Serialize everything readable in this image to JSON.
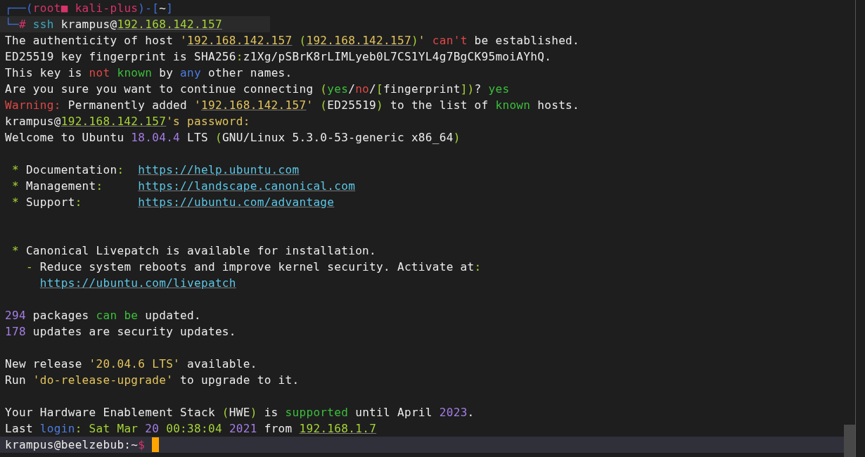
{
  "terminal": {
    "lines": [
      {
        "kind": "text",
        "highlighted": false,
        "segments": [
          {
            "kind": "frame",
            "text": "┌──("
          },
          {
            "kind": "root",
            "text": "root■ kali-plus"
          },
          {
            "kind": "frame",
            "text": ")-["
          },
          {
            "kind": "plain",
            "text": "~"
          },
          {
            "kind": "frame",
            "text": "]"
          }
        ]
      },
      {
        "kind": "text",
        "highlighted": true,
        "segments": [
          {
            "kind": "frame",
            "text": "└─"
          },
          {
            "kind": "root",
            "text": "#"
          },
          {
            "kind": "cmd",
            "text": " ssh"
          },
          {
            "kind": "plain",
            "text": " krampus@"
          },
          {
            "kind": "ip",
            "text": "192.168.142.157"
          }
        ]
      },
      {
        "kind": "text",
        "highlighted": false,
        "segments": [
          {
            "kind": "plain",
            "text": "The authenticity of host "
          },
          {
            "kind": "str",
            "text": "'"
          },
          {
            "kind": "strip",
            "text": "192.168.142.157"
          },
          {
            "kind": "punct",
            "text": " ("
          },
          {
            "kind": "strip",
            "text": "192.168.142.157"
          },
          {
            "kind": "punct",
            "text": ")"
          },
          {
            "kind": "str",
            "text": "' "
          },
          {
            "kind": "red",
            "text": "can't"
          },
          {
            "kind": "plain",
            "text": " be established."
          }
        ]
      },
      {
        "kind": "text",
        "highlighted": false,
        "segments": [
          {
            "kind": "plain",
            "text": "ED25519 key fingerprint is SHA256"
          },
          {
            "kind": "punct",
            "text": ":"
          },
          {
            "kind": "plain",
            "text": "z1Xg/pSBrK8rLIMLyeb0L7CS1YL4g7BgCK95moiAYhQ."
          }
        ]
      },
      {
        "kind": "text",
        "highlighted": false,
        "segments": [
          {
            "kind": "plain",
            "text": "This key is "
          },
          {
            "kind": "red",
            "text": "not "
          },
          {
            "kind": "green",
            "text": "known"
          },
          {
            "kind": "plain",
            "text": " by "
          },
          {
            "kind": "blue",
            "text": "any"
          },
          {
            "kind": "plain",
            "text": " other names."
          }
        ]
      },
      {
        "kind": "text",
        "highlighted": false,
        "segments": [
          {
            "kind": "plain",
            "text": "Are you sure you want to continue connecting "
          },
          {
            "kind": "punct",
            "text": "("
          },
          {
            "kind": "green",
            "text": "yes"
          },
          {
            "kind": "plain",
            "text": "/"
          },
          {
            "kind": "red",
            "text": "no"
          },
          {
            "kind": "plain",
            "text": "/"
          },
          {
            "kind": "punct",
            "text": "["
          },
          {
            "kind": "plain",
            "text": "fingerprint"
          },
          {
            "kind": "punct",
            "text": "])"
          },
          {
            "kind": "plain",
            "text": "? "
          },
          {
            "kind": "green",
            "text": "yes"
          }
        ]
      },
      {
        "kind": "text",
        "highlighted": false,
        "segments": [
          {
            "kind": "red",
            "text": "Warning:"
          },
          {
            "kind": "plain",
            "text": " Permanently added "
          },
          {
            "kind": "str",
            "text": "'"
          },
          {
            "kind": "strip",
            "text": "192.168.142.157"
          },
          {
            "kind": "str",
            "text": "' "
          },
          {
            "kind": "punct",
            "text": "("
          },
          {
            "kind": "plain",
            "text": "ED25519"
          },
          {
            "kind": "punct",
            "text": ")"
          },
          {
            "kind": "plain",
            "text": " to the list of "
          },
          {
            "kind": "green",
            "text": "known"
          },
          {
            "kind": "plain",
            "text": " hosts."
          }
        ]
      },
      {
        "kind": "text",
        "highlighted": false,
        "segments": [
          {
            "kind": "plain",
            "text": "krampus@"
          },
          {
            "kind": "ip",
            "text": "192.168.142.157"
          },
          {
            "kind": "str",
            "text": "'s password:"
          }
        ]
      },
      {
        "kind": "text",
        "highlighted": false,
        "segments": [
          {
            "kind": "plain",
            "text": "Welcome to Ubuntu "
          },
          {
            "kind": "num",
            "text": "18.04.4"
          },
          {
            "kind": "plain",
            "text": " LTS "
          },
          {
            "kind": "punct",
            "text": "("
          },
          {
            "kind": "plain",
            "text": "GNU/Linux 5.3.0-53-generic x86_64"
          },
          {
            "kind": "punct",
            "text": ")"
          }
        ]
      },
      {
        "kind": "blank",
        "highlighted": false
      },
      {
        "kind": "text",
        "highlighted": false,
        "segments": [
          {
            "kind": "punct",
            "text": " *"
          },
          {
            "kind": "plain",
            "text": " Documentation"
          },
          {
            "kind": "punct",
            "text": ":  "
          },
          {
            "kind": "link",
            "text": "https://help.ubuntu.com"
          }
        ]
      },
      {
        "kind": "text",
        "highlighted": false,
        "segments": [
          {
            "kind": "punct",
            "text": " *"
          },
          {
            "kind": "plain",
            "text": " Management"
          },
          {
            "kind": "punct",
            "text": ":     "
          },
          {
            "kind": "link",
            "text": "https://landscape.canonical.com"
          }
        ]
      },
      {
        "kind": "text",
        "highlighted": false,
        "segments": [
          {
            "kind": "punct",
            "text": " *"
          },
          {
            "kind": "plain",
            "text": " Support"
          },
          {
            "kind": "punct",
            "text": ":        "
          },
          {
            "kind": "link",
            "text": "https://ubuntu.com/advantage"
          }
        ]
      },
      {
        "kind": "blank",
        "highlighted": false
      },
      {
        "kind": "blank",
        "highlighted": false
      },
      {
        "kind": "text",
        "highlighted": false,
        "segments": [
          {
            "kind": "punct",
            "text": " *"
          },
          {
            "kind": "plain",
            "text": " Canonical Livepatch is available for installation."
          }
        ]
      },
      {
        "kind": "text",
        "highlighted": false,
        "segments": [
          {
            "kind": "punct",
            "text": "   -"
          },
          {
            "kind": "plain",
            "text": " Reduce system reboots and improve kernel security. Activate at"
          },
          {
            "kind": "punct",
            "text": ":"
          }
        ]
      },
      {
        "kind": "indented",
        "highlighted": false,
        "segments": [
          {
            "kind": "link",
            "text": "https://ubuntu.com/livepatch"
          }
        ]
      },
      {
        "kind": "blank",
        "highlighted": false
      },
      {
        "kind": "text",
        "highlighted": false,
        "segments": [
          {
            "kind": "num",
            "text": "294"
          },
          {
            "kind": "plain",
            "text": " packages "
          },
          {
            "kind": "green",
            "text": "can be"
          },
          {
            "kind": "plain",
            "text": " updated."
          }
        ]
      },
      {
        "kind": "text",
        "highlighted": false,
        "segments": [
          {
            "kind": "num",
            "text": "178"
          },
          {
            "kind": "plain",
            "text": " updates are security updates."
          }
        ]
      },
      {
        "kind": "blank",
        "highlighted": false
      },
      {
        "kind": "text",
        "highlighted": false,
        "segments": [
          {
            "kind": "plain",
            "text": "New release "
          },
          {
            "kind": "str",
            "text": "'20.04.6 LTS'"
          },
          {
            "kind": "plain",
            "text": " available."
          }
        ]
      },
      {
        "kind": "text",
        "highlighted": false,
        "segments": [
          {
            "kind": "plain",
            "text": "Run "
          },
          {
            "kind": "str",
            "text": "'do-release-upgrade'"
          },
          {
            "kind": "plain",
            "text": " to upgrade to it."
          }
        ]
      },
      {
        "kind": "blank",
        "highlighted": false
      },
      {
        "kind": "text",
        "highlighted": false,
        "segments": [
          {
            "kind": "plain",
            "text": "Your Hardware Enablement Stack "
          },
          {
            "kind": "punct",
            "text": "("
          },
          {
            "kind": "plain",
            "text": "HWE"
          },
          {
            "kind": "punct",
            "text": ")"
          },
          {
            "kind": "plain",
            "text": " is "
          },
          {
            "kind": "green",
            "text": "supported"
          },
          {
            "kind": "plain",
            "text": " until April "
          },
          {
            "kind": "num",
            "text": "2023"
          },
          {
            "kind": "plain",
            "text": "."
          }
        ]
      },
      {
        "kind": "text",
        "highlighted": false,
        "segments": [
          {
            "kind": "plain",
            "text": "Last "
          },
          {
            "kind": "blue",
            "text": "login"
          },
          {
            "kind": "punct",
            "text": ": Sat Mar "
          },
          {
            "kind": "num",
            "text": "20"
          },
          {
            "kind": "punct",
            "text": " 00:38:04 "
          },
          {
            "kind": "num",
            "text": "2021"
          },
          {
            "kind": "plain",
            "text": " from "
          },
          {
            "kind": "ip",
            "text": "192.168.1.7"
          }
        ]
      },
      {
        "kind": "text",
        "highlighted": true,
        "segments": [
          {
            "kind": "plain",
            "text": "krampus@beelzebub:~"
          },
          {
            "kind": "root",
            "text": "$"
          }
        ]
      }
    ]
  }
}
